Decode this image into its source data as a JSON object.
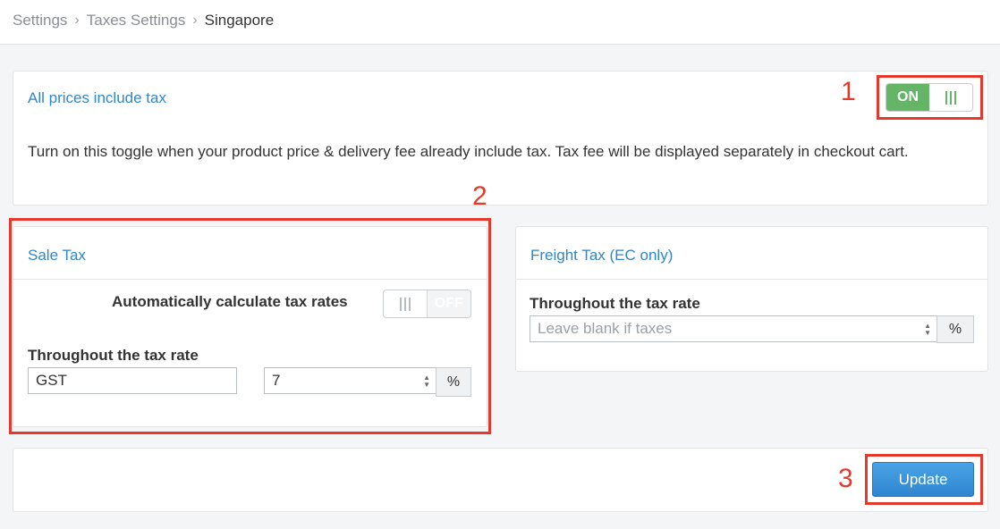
{
  "breadcrumb": {
    "items": [
      "Settings",
      "Taxes Settings",
      "Singapore"
    ]
  },
  "price_tax": {
    "title": "All prices include tax",
    "description": "Turn on this toggle when your product price & delivery fee already include tax. Tax fee will be displayed separately in checkout cart.",
    "toggle_label": "ON"
  },
  "sale_tax": {
    "title": "Sale Tax",
    "auto_label": "Automatically calculate tax rates",
    "auto_toggle_label": "OFF",
    "rate_label": "Throughout the tax rate",
    "tax_name_value": "GST",
    "tax_rate_value": "7",
    "unit": "%"
  },
  "freight_tax": {
    "title": "Freight Tax (EC only)",
    "rate_label": "Throughout the tax rate",
    "placeholder": "Leave blank if taxes",
    "unit": "%"
  },
  "actions": {
    "update_label": "Update"
  },
  "annotations": {
    "marker_1": "1",
    "marker_2": "2",
    "marker_3": "3"
  },
  "colors": {
    "accent": "#2f86c8",
    "toggle_on": "#65b566",
    "annotation": "#e53a2b",
    "button": "#3a93dc"
  }
}
